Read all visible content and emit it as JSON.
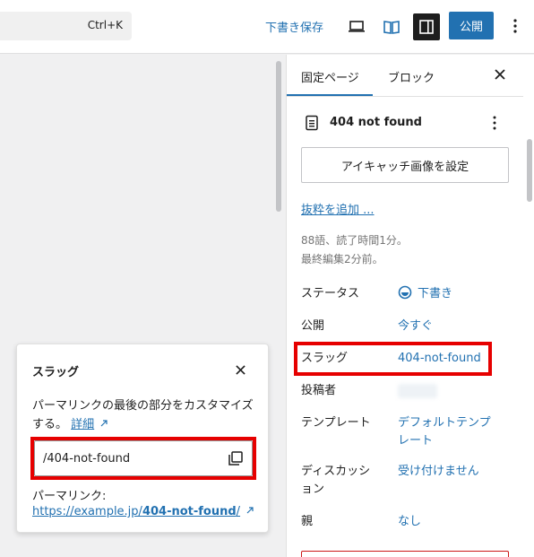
{
  "topbar": {
    "command_shortcut": "Ctrl+K",
    "save_draft": "下書き保存",
    "publish": "公開",
    "accent_color": "#2271b1"
  },
  "sidebar": {
    "tabs": [
      {
        "label": "固定ページ",
        "active": true
      },
      {
        "label": "ブロック",
        "active": false
      }
    ],
    "page_title": "404 not found",
    "featured_image_button": "アイキャッチ画像を設定",
    "add_excerpt_link": "抜粋を追加 ...",
    "stats": {
      "reading": "88語、読了時間1分。",
      "edited": "最終編集2分前。"
    },
    "meta": [
      {
        "label": "ステータス",
        "value": "下書き"
      },
      {
        "label": "公開",
        "value": "今すぐ"
      },
      {
        "label": "スラッグ",
        "value": "404-not-found"
      },
      {
        "label": "投稿者",
        "value": ""
      },
      {
        "label": "テンプレート",
        "value": "デフォルトテンプレート"
      },
      {
        "label": "ディスカッション",
        "value": "受け付けません"
      },
      {
        "label": "親",
        "value": "なし"
      }
    ]
  },
  "slug_popover": {
    "title": "スラッグ",
    "description": "パーマリンクの最後の部分をカスタマイズする。",
    "details_link": "詳細",
    "slug_value": "/404-not-found",
    "permalink_label": "パーマリンク:",
    "permalink_prefix": "https://example.jp/",
    "permalink_slug": "404-not-found",
    "permalink_suffix": "/"
  },
  "highlight_color": "#e60000"
}
